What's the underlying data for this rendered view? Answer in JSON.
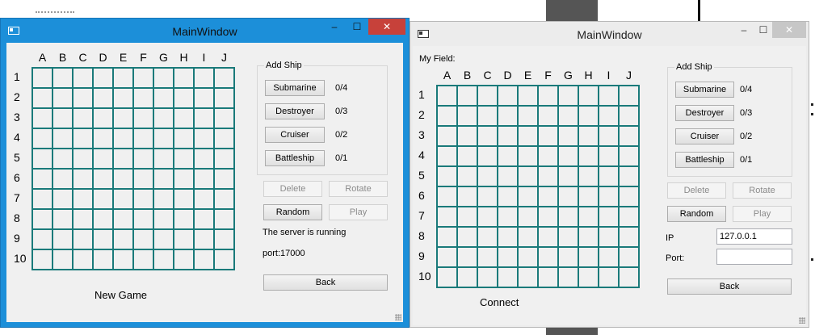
{
  "left_window": {
    "title": "MainWindow",
    "columns": [
      "A",
      "B",
      "C",
      "D",
      "E",
      "F",
      "G",
      "H",
      "I",
      "J"
    ],
    "rows": [
      "1",
      "2",
      "3",
      "4",
      "5",
      "6",
      "7",
      "8",
      "9",
      "10"
    ],
    "add_ship_title": "Add Ship",
    "ships": [
      {
        "label": "Submarine",
        "count": "0/4"
      },
      {
        "label": "Destroyer",
        "count": "0/3"
      },
      {
        "label": "Cruiser",
        "count": "0/2"
      },
      {
        "label": "Battleship",
        "count": "0/1"
      }
    ],
    "delete_label": "Delete",
    "rotate_label": "Rotate",
    "random_label": "Random",
    "play_label": "Play",
    "status_text": "The server is running",
    "port_text": "port:17000",
    "back_label": "Back",
    "bottom_label": "New Game"
  },
  "right_window": {
    "title": "MainWindow",
    "field_label": "My Field:",
    "columns": [
      "A",
      "B",
      "C",
      "D",
      "E",
      "F",
      "G",
      "H",
      "I",
      "J"
    ],
    "rows": [
      "1",
      "2",
      "3",
      "4",
      "5",
      "6",
      "7",
      "8",
      "9",
      "10"
    ],
    "add_ship_title": "Add Ship",
    "ships": [
      {
        "label": "Submarine",
        "count": "0/4"
      },
      {
        "label": "Destroyer",
        "count": "0/3"
      },
      {
        "label": "Cruiser",
        "count": "0/2"
      },
      {
        "label": "Battleship",
        "count": "0/1"
      }
    ],
    "delete_label": "Delete",
    "rotate_label": "Rotate",
    "random_label": "Random",
    "play_label": "Play",
    "ip_label": "IP",
    "ip_value": "127.0.0.1",
    "port_label": "Port:",
    "port_value": "",
    "back_label": "Back",
    "bottom_label": "Connect"
  },
  "controls": {
    "minimize_glyph": "–",
    "maximize_glyph": "☐",
    "close_glyph": "✕"
  },
  "colors": {
    "grid": "#1a7a7a",
    "active_title": "#1c8fd9",
    "close_active": "#c7413a"
  }
}
